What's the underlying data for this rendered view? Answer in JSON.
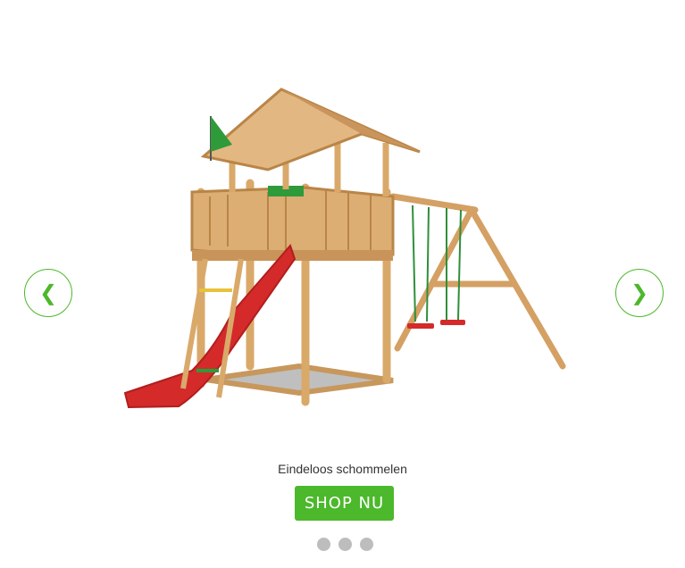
{
  "slider": {
    "prev_arrow": "❮",
    "next_arrow": "❯",
    "caption": "Eindeloos schommelen",
    "cta_label": "SHOP NU",
    "dots_count": 3,
    "product_image": "wooden-playhouse-with-slide-and-swings"
  },
  "colors": {
    "accent": "#4cb82b",
    "dot": "#bdbdbd",
    "wood": "#d9a96a",
    "slide": "#d42a2a"
  }
}
